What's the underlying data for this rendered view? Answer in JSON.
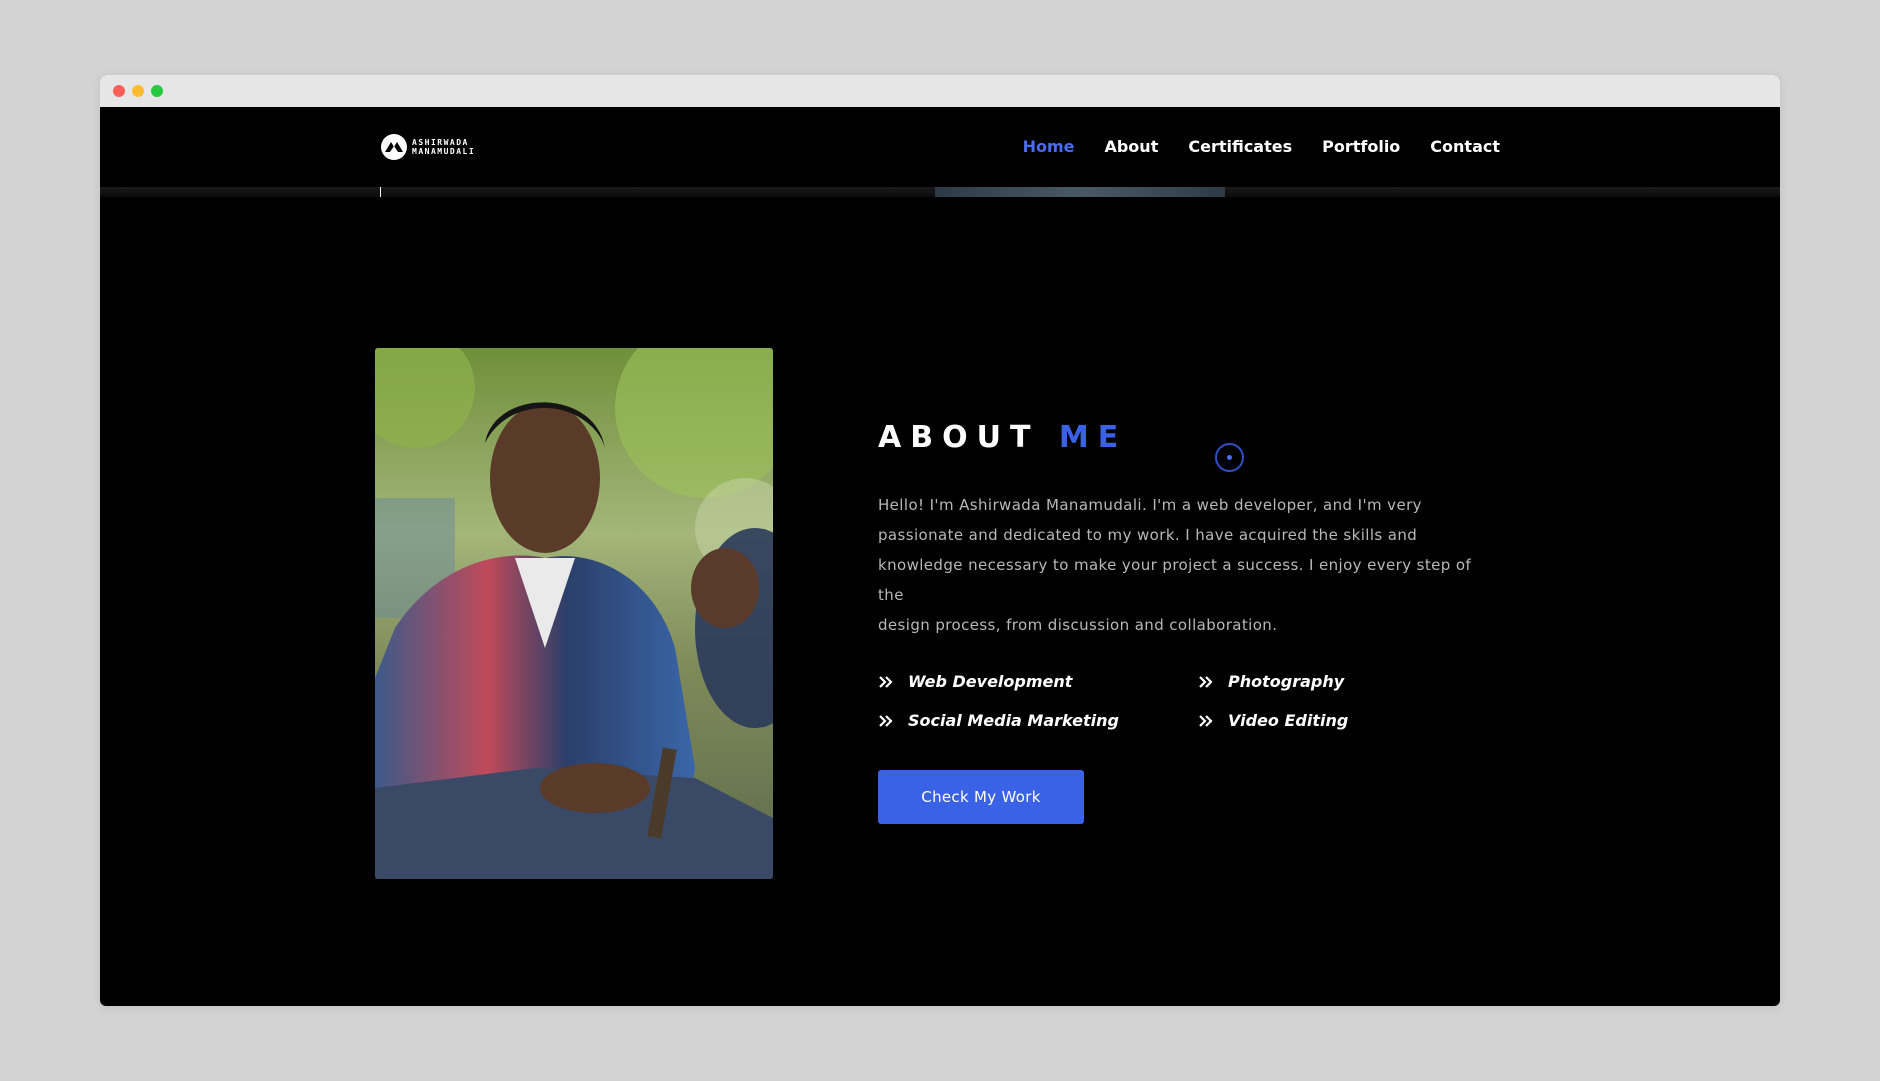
{
  "window": {
    "traffic_lights": [
      "#ff5f57",
      "#febc2e",
      "#28c840"
    ]
  },
  "brand": {
    "line1": "ASHIRWADA",
    "line2": "MANAMUDALI",
    "icon": "logo-mark-icon"
  },
  "nav": {
    "items": [
      {
        "label": "Home",
        "active": true
      },
      {
        "label": "About",
        "active": false
      },
      {
        "label": "Certificates",
        "active": false
      },
      {
        "label": "Portfolio",
        "active": false
      },
      {
        "label": "Contact",
        "active": false
      }
    ]
  },
  "about": {
    "title_main": "ABOUT",
    "title_accent": "ME",
    "description_line1": "Hello! I'm Ashirwada Manamudali. I'm a web developer, and I'm very",
    "description_line2": "passionate and dedicated to my work. I have acquired the skills and",
    "description_line3": "knowledge necessary to make your project a success. I enjoy every step of the",
    "description_line4": "design process, from discussion and collaboration.",
    "skills": [
      "Web Development",
      "Photography",
      "Social Media Marketing",
      "Video Editing"
    ],
    "cta_label": "Check My Work"
  },
  "colors": {
    "accent": "#3a62e6",
    "nav_active": "#4a6cf0",
    "background": "#000000",
    "text_muted": "#b8b8b8"
  }
}
